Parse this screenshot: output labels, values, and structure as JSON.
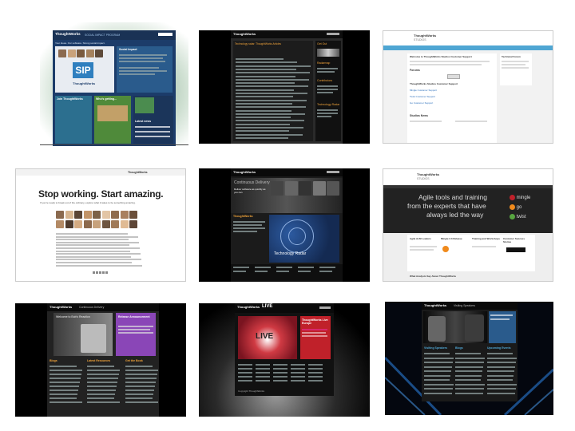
{
  "thumbs": {
    "t1": {
      "logo": "ThoughtWorks",
      "header_text": "SOCIAL IMPACT PROGRAM",
      "tagline": "Your ideas. Our software. Strong social impact.",
      "panel_title": "Social Impact",
      "box1": "Join ThoughtWorks",
      "box2": "Who's getting...",
      "news": "Latest news",
      "slide_text": "SIP"
    },
    "t2": {
      "logo": "ThoughtWorks",
      "heading": "Technology radar: ThoughtWorks Articles",
      "side1": "Get Out",
      "side2": "Radarmap",
      "side3": "Contributors",
      "side4": "Technology Radar"
    },
    "t3": {
      "logo": "ThoughtWorks",
      "sub": "STUDIOS",
      "welcome": "Welcome to ThoughtWorks Studios Customer Support",
      "forums": "Forums",
      "support_title": "ThoughtWorks Studios Customer Support",
      "links": [
        "Mingle Customer Support",
        "Twist Customer Support",
        "Go Customer Support"
      ],
      "news_title": "Studios News",
      "right_title": "Technical Forum"
    },
    "t4": {
      "logo": "ThoughtWorks",
      "headline": "Stop working. Start amazing.",
      "sub": "If you're ready to break out of the ordinary, explore what it takes to be something amazing."
    },
    "t5": {
      "logo": "ThoughtWorks",
      "title": "Continuous Delivery",
      "subtitle": "Deliver software as quickly as you can",
      "banner": "Technology Radar",
      "side": "ThoughtWorks"
    },
    "t6": {
      "logo": "ThoughtWorks",
      "sub": "STUDIOS",
      "hero_1": "Agile tools and training",
      "hero_2": "from the experts that have",
      "hero_3": "always led the way",
      "products": [
        "mingle",
        "go",
        "twist"
      ],
      "cols": [
        "Agile ALM Leaders",
        "Mingle 3.3 Release",
        "Training and Workshops",
        "Customer Success Stories"
      ],
      "bottom": "What Analysts Say About ThoughtWorks"
    },
    "t7": {
      "logo": "ThoughtWorks",
      "title": "Continuous Delivery",
      "hero": "Welcome to Bob's Reaction",
      "side": "Release Announcement",
      "cols": [
        "Blogs",
        "Latest Resources",
        "Get the Book"
      ]
    },
    "t8": {
      "logo": "ThoughtWorks",
      "live": "LIVE",
      "banner": "LIVE",
      "side": "ThoughtWorks Live Europe",
      "footer": "Copyright ThoughtWorks"
    },
    "t9": {
      "logo": "ThoughtWorks",
      "title": "Visiting Speakers",
      "cols": [
        "Visiting Speakers",
        "Blogs",
        "Upcoming Events"
      ]
    }
  },
  "colors": {
    "twblue": "#3b5f8c",
    "dark": "#111111",
    "purple": "#8a46b7",
    "studio_blue": "#4fa6d3",
    "orange": "#f08a1c",
    "red": "#c0212a"
  }
}
